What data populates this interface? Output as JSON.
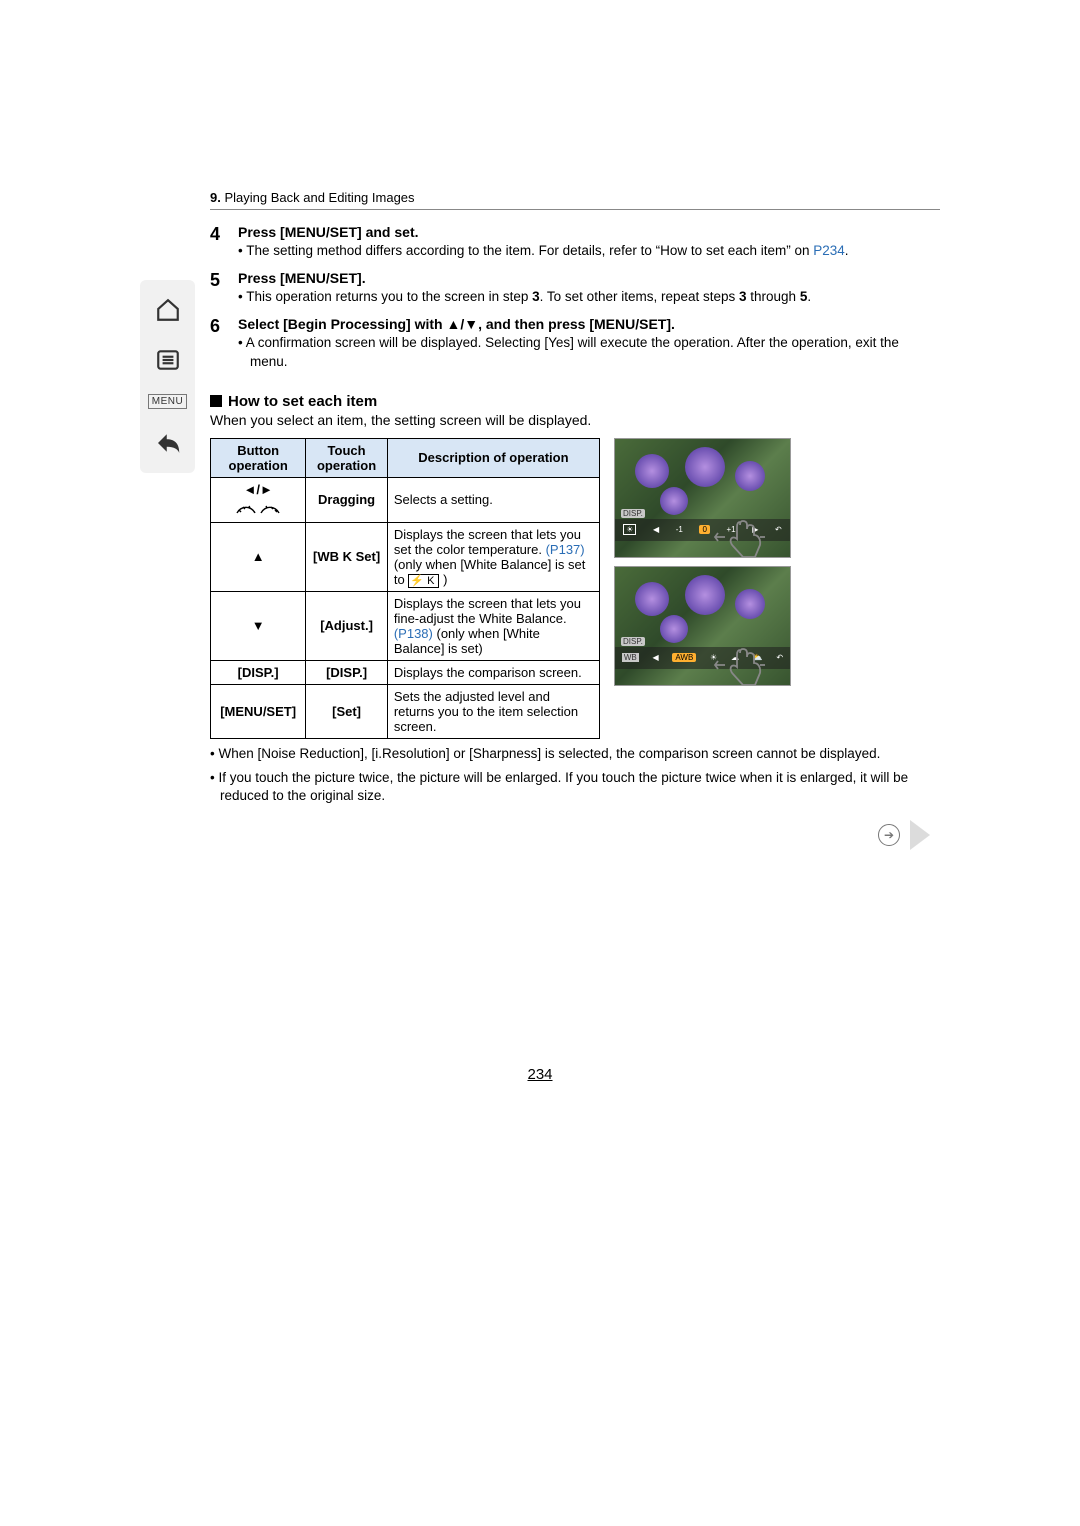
{
  "header": {
    "chapter_num": "9.",
    "chapter_title": "Playing Back and Editing Images"
  },
  "sidenav": {
    "menu_label": "MENU"
  },
  "steps": {
    "s4": {
      "num": "4",
      "title": "Press [MENU/SET] and set.",
      "bullet_lead": "• The setting method differs according to the item. For details, refer to “How to set each item” on ",
      "link": "P234",
      "tail": "."
    },
    "s5": {
      "num": "5",
      "title": "Press [MENU/SET].",
      "bullet_a": "• This operation returns you to the screen in step ",
      "three_a": "3",
      "bullet_b": ". To set other items, repeat steps ",
      "three_b": "3",
      "bullet_c": " through ",
      "five": "5",
      "bullet_d": "."
    },
    "s6": {
      "num": "6",
      "title_a": "Select [Begin Processing] with ",
      "title_arrows": "▲/▼",
      "title_b": ", and then press [MENU/SET].",
      "bullet": "• A confirmation screen will be displayed. Selecting [Yes] will execute the operation. After the operation, exit the menu."
    }
  },
  "howto": {
    "heading": "How to set each item",
    "intro": "When you select an item, the setting screen will be displayed."
  },
  "table": {
    "h1": "Button operation",
    "h2": "Touch operation",
    "h3": "Description of operation",
    "r1": {
      "btn": "◄/►",
      "touch": "Dragging",
      "desc": "Selects a setting."
    },
    "r2": {
      "btn": "▲",
      "touch": "[WB K Set]",
      "desc_a": "Displays the screen that lets you set the color temperature. ",
      "link": "(P137)",
      "desc_b": " (only when [White Balance] is set to ",
      "icon": " K ",
      "desc_c": " )"
    },
    "r3": {
      "btn": "▼",
      "touch": "[Adjust.]",
      "desc_a": "Displays the screen that lets you fine-adjust the White Balance. ",
      "link": "(P138)",
      "desc_b": " (only when [White Balance] is set)"
    },
    "r4": {
      "btn": "[DISP.]",
      "touch": "[DISP.]",
      "desc": "Displays the comparison screen."
    },
    "r5": {
      "btn": "[MENU/SET]",
      "touch": "[Set]",
      "desc": "Sets the adjusted level and returns you to the item selection screen."
    }
  },
  "preview": {
    "img1_tag": "DISP.",
    "img1_labels": {
      "minus1": "-1",
      "zero": "0",
      "plus1": "+1"
    },
    "img2_tag": "DISP.",
    "img2_wb": "WB",
    "img2_awb": "AWB"
  },
  "notes": {
    "n1": "• When [Noise Reduction], [i.Resolution] or [Sharpness] is selected, the comparison screen cannot be displayed.",
    "n2": "• If you touch the picture twice, the picture will be enlarged. If you touch the picture twice when it is enlarged, it will be reduced to the original size."
  },
  "page_number": "234"
}
